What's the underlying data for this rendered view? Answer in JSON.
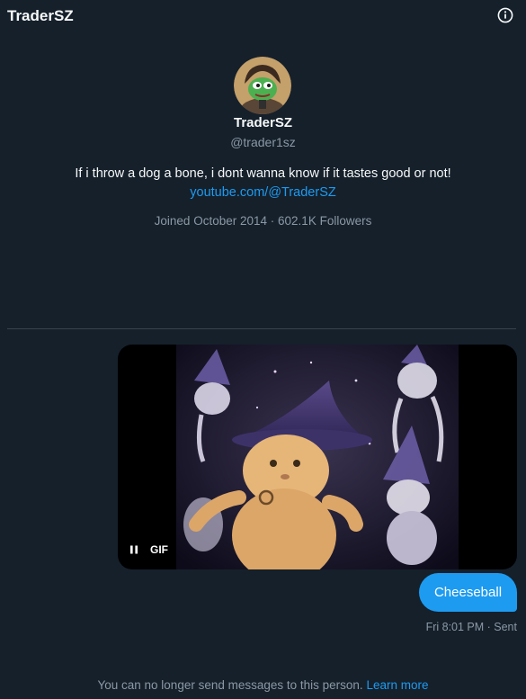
{
  "header": {
    "title": "TraderSZ",
    "info_icon": "info-circle-icon"
  },
  "profile": {
    "display_name": "TraderSZ",
    "handle": "@trader1sz",
    "bio": "If i throw a dog a bone, i dont wanna know if it tastes good or not!",
    "link": "youtube.com/@TraderSZ",
    "joined": "Joined October 2014",
    "separator": "·",
    "followers": "602.1K Followers"
  },
  "messages": {
    "gif": {
      "badge": "GIF",
      "pause_icon": "pause-icon"
    },
    "text_bubble": "Cheeseball",
    "timestamp": "Fri 8:01 PM · Sent"
  },
  "footer": {
    "notice": "You can no longer send messages to this person.",
    "learn_more": "Learn more"
  },
  "colors": {
    "background": "#15202b",
    "accent": "#1d9bf0",
    "muted": "#8b98a5",
    "divider": "#38444d"
  }
}
